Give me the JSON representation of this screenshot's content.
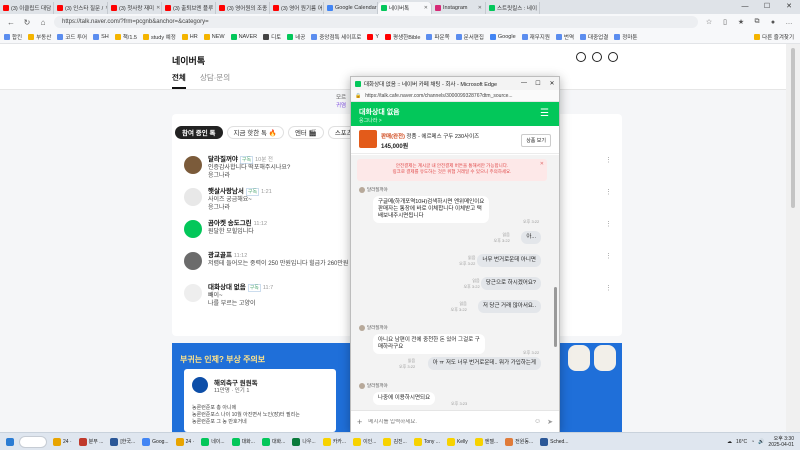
{
  "browser": {
    "tabs": [
      {
        "label": "(3) 이클립드 대담 .",
        "color": "#ff0000"
      },
      {
        "label": "(3) 인스타 질문 /",
        "color": "#ff0000"
      },
      {
        "label": "(3) 첫사랑 재미",
        "color": "#ff0000"
      },
      {
        "label": "(3) 출퇴브엔 플루 필",
        "color": "#ff0000"
      },
      {
        "label": "(3) 영어원의 조종",
        "color": "#ff0000"
      },
      {
        "label": "(3) 영어 원기름 어",
        "color": "#ff0000"
      },
      {
        "label": "Google Calendar -",
        "color": "#4285f4"
      },
      {
        "label": "네이버톡",
        "color": "#03c75a"
      },
      {
        "label": "Instagram",
        "color": "#d62976"
      },
      {
        "label": "스트릿킬스 : 네이",
        "color": "#03c75a"
      }
    ],
    "url": "https://talk.naver.com/?frm=pcgnb&anchor=&category=",
    "bookmarks": [
      {
        "label": "합킨",
        "color": "#5b8def"
      },
      {
        "label": "부동산",
        "color": "#f4b400"
      },
      {
        "label": "코드 투어",
        "color": "#5b8def"
      },
      {
        "label": "SH",
        "color": "#5b8def"
      },
      {
        "label": "책/1.5",
        "color": "#f4b400"
      },
      {
        "label": "study 예정",
        "color": "#f4b400"
      },
      {
        "label": "HR",
        "color": "#f4b400"
      },
      {
        "label": "NEW",
        "color": "#f4b400"
      },
      {
        "label": "NAVER",
        "color": "#03c75a"
      },
      {
        "label": "디토",
        "color": "#444444"
      },
      {
        "label": "네공",
        "color": "#03c75a"
      },
      {
        "label": "중앙점특 세이프로",
        "color": "#5b8def"
      },
      {
        "label": "Y",
        "color": "#ff0000"
      },
      {
        "label": "평생한Bible",
        "color": "#ff0000"
      },
      {
        "label": "파운쪽",
        "color": "#5b8def"
      },
      {
        "label": "문서편집",
        "color": "#5b8def"
      },
      {
        "label": "Google",
        "color": "#4285f4"
      },
      {
        "label": "재무지원",
        "color": "#5b8def"
      },
      {
        "label": "번역",
        "color": "#5b8def"
      },
      {
        "label": "대중업결",
        "color": "#5b8def"
      },
      {
        "label": "정마툰",
        "color": "#5b8def"
      }
    ],
    "bookmarks_more": "다른 즐겨찾기"
  },
  "cafe": {
    "title": "네이버톡",
    "tabs": {
      "all": "전체",
      "consult": "상담·문의"
    },
    "notice_line1": "모르",
    "notice_line2": "귀염",
    "filters": [
      "참여 중인 톡",
      "지금 핫한 톡",
      "엔터",
      "스포츠"
    ],
    "filter_emojis": [
      "",
      "🔥",
      "🎬",
      "⚾"
    ],
    "chats": [
      {
        "name": "달라질꺼야",
        "tag": "구독",
        "time": "10분 전",
        "line1": "인증감사합니다 떡포해주시나요?",
        "line2": "응그나라",
        "avatar": "#7b5b3a"
      },
      {
        "name": "햇살사랑남서",
        "tag": "구독",
        "time": "1:21",
        "line1": "사이즈 궁금해요~",
        "line2": "응그나라",
        "avatar": "#e8e8e8"
      },
      {
        "name": "곰아켓 송도그린",
        "tag": "",
        "time": "11:12",
        "line1": "원달한 모힐입니다",
        "line2": "",
        "avatar": "#03c75a"
      },
      {
        "name": "광교골프",
        "tag": "",
        "time": "11:12",
        "line1": "저렴테 들어오는 중력이 250 만원입니다 힐급가 260만원",
        "line2": "",
        "avatar": "#6b6b6b"
      },
      {
        "name": "대화상대 없음",
        "tag": "구독",
        "time": "11:7",
        "line1": "빼이~",
        "line2": "나를 부르는 고양이",
        "avatar": "#eeeeee"
      }
    ],
    "banner_title": "부귀는 인제? 부상 주의보",
    "banner_card": {
      "name": "해외축구 원원독",
      "sub": "11만명 · 인기 1",
      "text1": "농론런준포 총 아니에",
      "text2": "농론런준포스 나이 10월 아진면서 노인(장)터 필리는",
      "text3": "농론런준포 그 농 만호거네"
    }
  },
  "popup": {
    "window_title": "대화상대 없음 :: 네이버 카페 채팅 - 회사 - Microsoft Edge",
    "url": "https://talk.cafe.naver.com/channels/300009932876?dtm_source...",
    "header_title": "대화상대 없음",
    "header_sub": "응그나라 >",
    "product": {
      "status": "판매(완전)",
      "name": " 정품 - 에르메스 구두 230사이즈",
      "price": "145,000원",
      "button": "상품 보기"
    },
    "warning_line1": "안전결제는 계시글 내 안전결제 버튼을 통해서만 가능합니다.",
    "warning_line2": "링크로 결제를 유도하는 것은 위험 거래일 수 있으니 주의하세요.",
    "messages": [
      {
        "side": "left",
        "sender": "달라질꺼야",
        "text1": "구글메(하개포역10H)검색하시면 엔위메인이요",
        "text2": "판매자는 통장에 바로 이체합니다 이체받고 택",
        "text3": "배보내주시면됩니다",
        "time": "오후 3:22"
      },
      {
        "side": "right",
        "text1": "아...",
        "time": "오후 3:22",
        "read": "읽음"
      },
      {
        "side": "right",
        "text1": "너무 번거로운데 아니면",
        "time": "오후 3:22",
        "read": "읽음"
      },
      {
        "side": "right",
        "text1": "당근으로 하시겠어요?",
        "time": "오후 3:22",
        "read": "읽음"
      },
      {
        "side": "right",
        "text1": "저 당근 거래 많아서요..",
        "time": "오후 3:22",
        "read": "읽음"
      },
      {
        "side": "left",
        "sender": "달라질꺼야",
        "text1": "아니요 남편이 전에 중천한 돈 있어 그걸로 구",
        "text2": "매하라구요",
        "time": "오후 3:22"
      },
      {
        "side": "right",
        "text1": "아 ㅠ 저도 너무 번거로운데.. 뭐가 가입하는게",
        "time": "오후 3:22",
        "read": "읽음"
      },
      {
        "side": "left",
        "sender": "달라질꺼야",
        "text1": "나중에 이용하시면되요",
        "time": "오후 3:23"
      }
    ],
    "input_placeholder": "메시지를 입력하세요."
  },
  "taskbar": {
    "items": [
      {
        "label": "24 ·",
        "color": "#e8a400"
      },
      {
        "label": "분부 ...",
        "color": "#c0392b"
      },
      {
        "label": "[한국...",
        "color": "#2b5797"
      },
      {
        "label": "Goog...",
        "color": "#4285f4"
      },
      {
        "label": "24 ·",
        "color": "#e8a400"
      },
      {
        "label": "네이...",
        "color": "#03c75a"
      },
      {
        "label": "대화...",
        "color": "#03c75a"
      },
      {
        "label": "대화...",
        "color": "#03c75a"
      },
      {
        "label": "나우...",
        "color": "#0a7a3a"
      },
      {
        "label": "카카...",
        "color": "#f7d200"
      },
      {
        "label": "이인...",
        "color": "#f7d200"
      },
      {
        "label": "김진...",
        "color": "#f7d200"
      },
      {
        "label": "Tony ...",
        "color": "#f7d200"
      },
      {
        "label": "Kelly",
        "color": "#f7d200"
      },
      {
        "label": "엔젤...",
        "color": "#f7d200"
      },
      {
        "label": "전원동...",
        "color": "#e07b39"
      },
      {
        "label": "Sched...",
        "color": "#2b5797"
      }
    ],
    "temp": "16°C",
    "time": "오후 3:30",
    "date": "2025-04-01"
  }
}
